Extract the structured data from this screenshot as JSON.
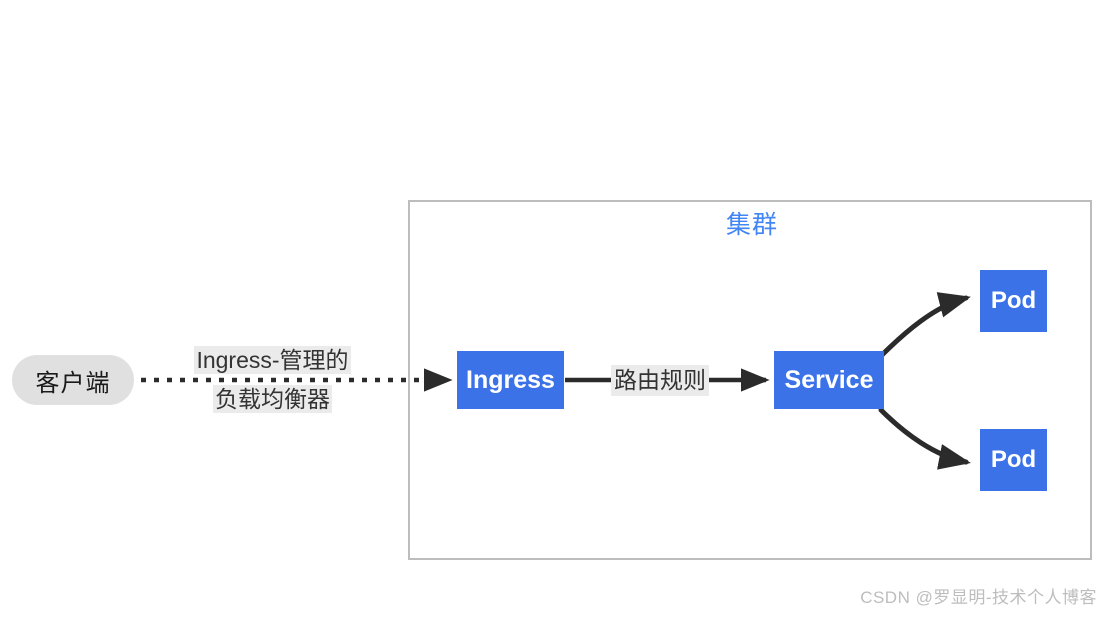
{
  "diagram": {
    "title_hidden": "",
    "cluster": {
      "label": "集群",
      "border_color": "#bdbdbd",
      "label_color": "#4285f4"
    },
    "nodes": {
      "client": {
        "label": "客户端",
        "fill": "#e0e0e0",
        "text_color": "#1a1a1a",
        "shape": "rounded-rect"
      },
      "ingress": {
        "label": "Ingress",
        "fill": "#3b72e8",
        "text_color": "#ffffff",
        "shape": "rect"
      },
      "service": {
        "label": "Service",
        "fill": "#3b72e8",
        "text_color": "#ffffff",
        "shape": "rect"
      },
      "pod_top": {
        "label": "Pod",
        "fill": "#3b72e8",
        "text_color": "#ffffff",
        "shape": "rect"
      },
      "pod_bottom": {
        "label": "Pod",
        "fill": "#3b72e8",
        "text_color": "#ffffff",
        "shape": "rect"
      }
    },
    "edges": {
      "client_to_ingress": {
        "label_line1": "Ingress-管理的",
        "label_line2": "负载均衡器",
        "style": "dotted",
        "color": "#2b2b2b"
      },
      "ingress_to_service": {
        "label": "路由规则",
        "style": "solid",
        "color": "#2b2b2b"
      },
      "service_to_pod_top": {
        "label": "",
        "style": "curved",
        "color": "#2b2b2b"
      },
      "service_to_pod_bottom": {
        "label": "",
        "style": "curved",
        "color": "#2b2b2b"
      }
    }
  },
  "watermark": {
    "text": "CSDN @罗显明-技术个人博客",
    "color": "#bdbdbd"
  }
}
